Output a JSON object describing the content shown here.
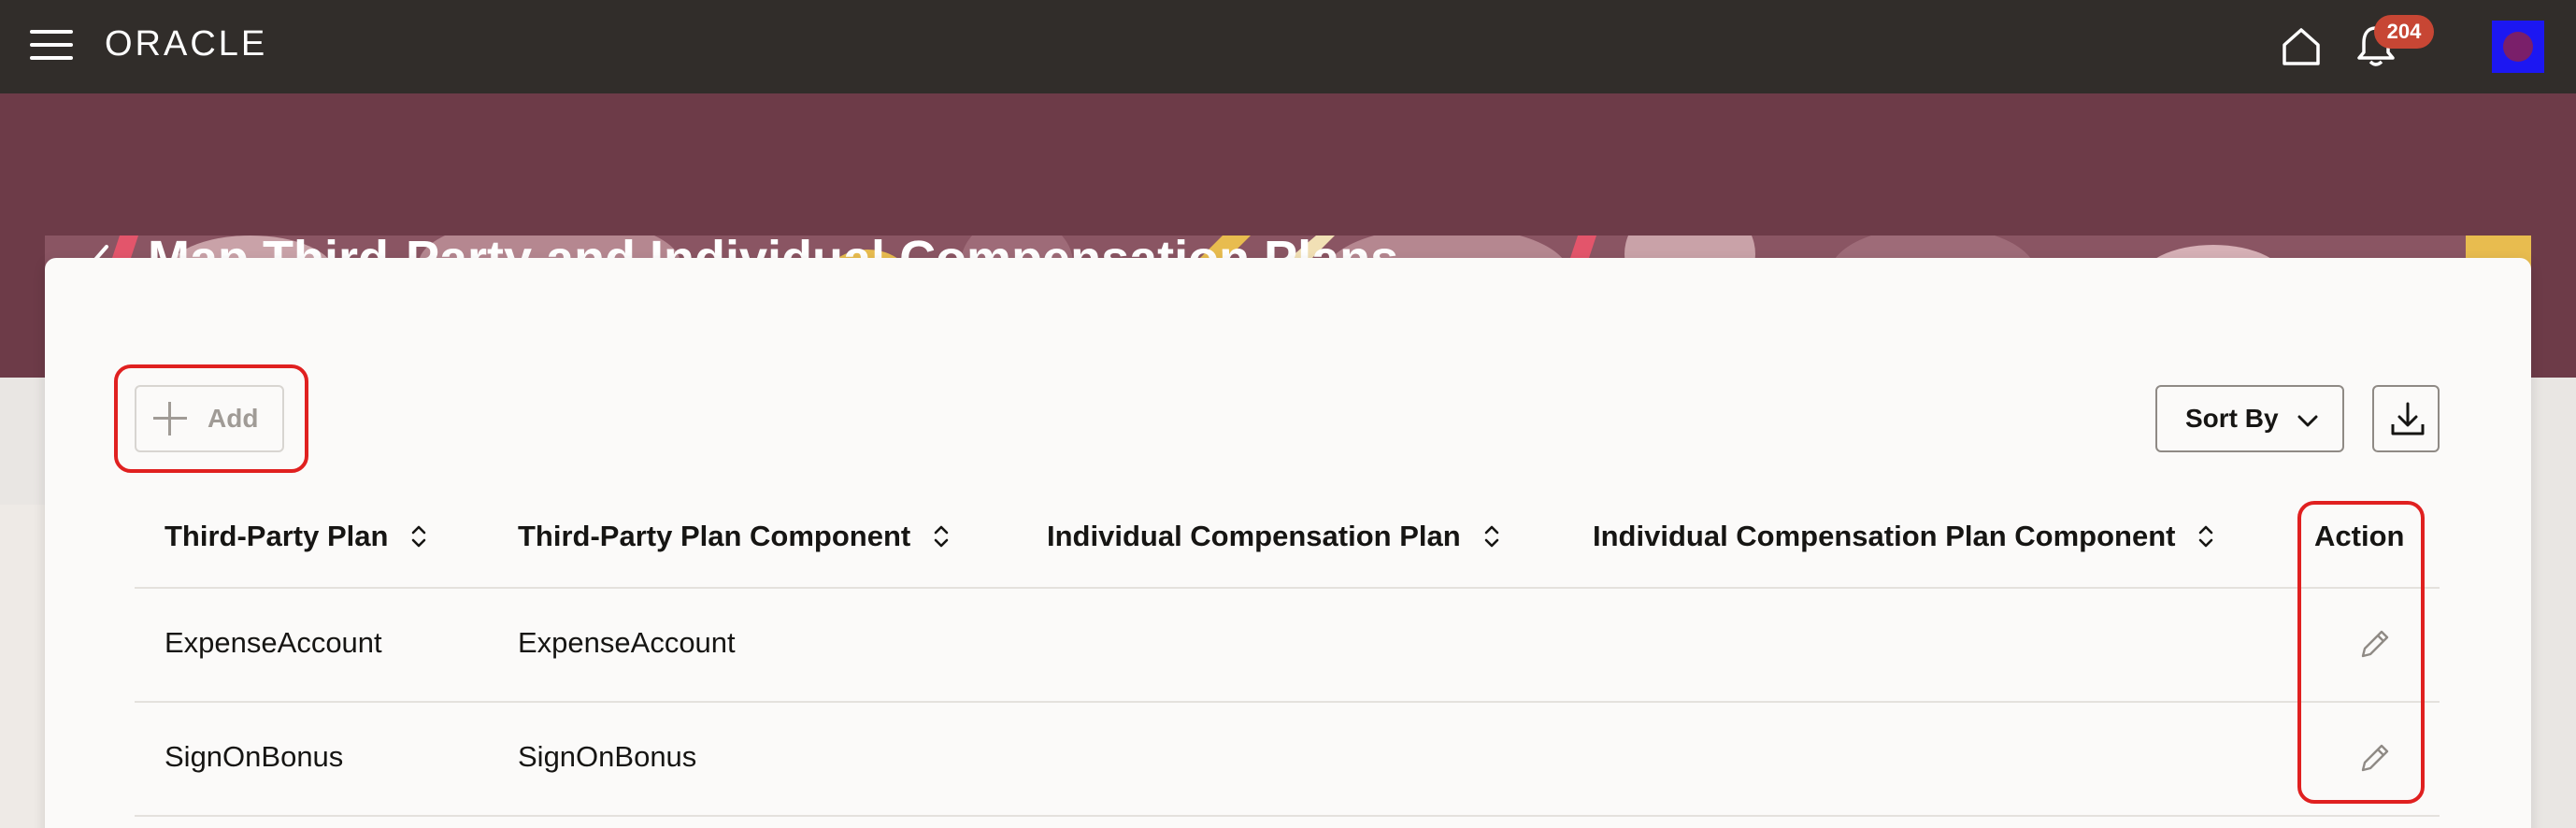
{
  "topbar": {
    "logo": "ORACLE",
    "notification_count": "204",
    "icons": [
      "hamburger-menu-icon",
      "home-icon",
      "bell-icon",
      "user-avatar"
    ]
  },
  "header": {
    "title": "Map Third-Party and Individual Compensation Plans"
  },
  "toolbar": {
    "add_label": "Add",
    "sort_label": "Sort By"
  },
  "table": {
    "columns": [
      "Third-Party Plan",
      "Third-Party Plan Component",
      "Individual Compensation Plan",
      "Individual Compensation Plan Component",
      "Action"
    ],
    "rows": [
      [
        "ExpenseAccount",
        "ExpenseAccount",
        "",
        ""
      ],
      [
        "SignOnBonus",
        "SignOnBonus",
        "",
        ""
      ]
    ]
  },
  "colors": {
    "topbar": "#312d2a",
    "header_band": "#6d3b48",
    "highlight": "#e02020",
    "badge": "#c74634"
  }
}
